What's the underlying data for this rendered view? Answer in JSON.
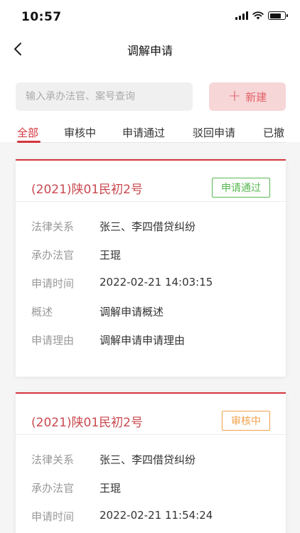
{
  "status_bar": {
    "time": "10:57"
  },
  "nav": {
    "title": "调解申请"
  },
  "search": {
    "placeholder": "输入承办法官、案号查询"
  },
  "new_button": {
    "label": "新建",
    "icon": "plus-icon"
  },
  "tabs": [
    {
      "label": "全部",
      "active": true
    },
    {
      "label": "审核中",
      "active": false
    },
    {
      "label": "申请通过",
      "active": false
    },
    {
      "label": "驳回申请",
      "active": false
    },
    {
      "label": "已撤",
      "active": false
    }
  ],
  "colors": {
    "accent": "#d4363e",
    "approved": "#58b752",
    "pending": "#f0a24b"
  },
  "cards": [
    {
      "case_no": "(2021)陕01民初2号",
      "status": "申请通过",
      "status_color": "#58b752",
      "fields": [
        {
          "label": "法律关系",
          "value": "张三、李四借贷纠纷"
        },
        {
          "label": "承办法官",
          "value": "王琨"
        },
        {
          "label": "申请时间",
          "value": "2022-02-21 14:03:15"
        },
        {
          "label": "概述",
          "value": "调解申请概述"
        },
        {
          "label": "申请理由",
          "value": "调解申请申请理由"
        }
      ]
    },
    {
      "case_no": "(2021)陕01民初2号",
      "status": "审核中",
      "status_color": "#f0a24b",
      "fields": [
        {
          "label": "法律关系",
          "value": "张三、李四借贷纠纷"
        },
        {
          "label": "承办法官",
          "value": "王琨"
        },
        {
          "label": "申请时间",
          "value": "2022-02-21 11:54:24"
        }
      ]
    }
  ]
}
